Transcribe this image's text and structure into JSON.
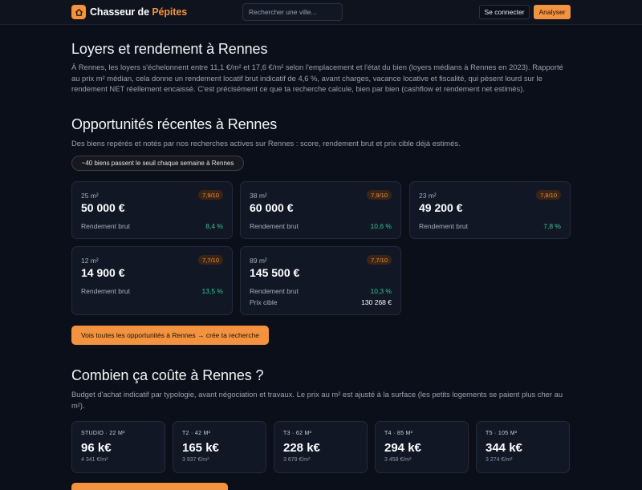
{
  "header": {
    "logo_part1": "Chasseur de ",
    "logo_part2": "Pépites",
    "logo_icon": "house-icon",
    "search_placeholder": "Rechercher une ville...",
    "login_label": "Se connecter",
    "analyse_label": "Analyser"
  },
  "rent": {
    "title": "Loyers et rendement à Rennes",
    "text": "À Rennes, les loyers s'échelonnent entre 11,1 €/m² et 17,6 €/m² selon l'emplacement et l'état du bien (loyers médians à Rennes en 2023). Rapporté au prix m² médian, cela donne un rendement locatif brut indicatif de 4,6 %, avant charges, vacance locative et fiscalité, qui pèsent lourd sur le rendement NET réellement encaissé. C'est précisément ce que ta recherche calcule, bien par bien (cashflow et rendement net estimés)."
  },
  "opportunities": {
    "title": "Opportunités récentes à Rennes",
    "subtitle": "Des biens repérés et notés par nos recherches actives sur Rennes : score, rendement brut et prix cible déjà estimés.",
    "pill": "~40 biens passent le seuil chaque semaine à Rennes",
    "yield_label": "Rendement brut",
    "target_label": "Prix cible",
    "cards": [
      {
        "surface": "25 m²",
        "score": "7,9/10",
        "price": "50 000 €",
        "yield": "8,4 %"
      },
      {
        "surface": "38 m²",
        "score": "7,9/10",
        "price": "60 000 €",
        "yield": "10,6 %"
      },
      {
        "surface": "23 m²",
        "score": "7,8/10",
        "price": "49 200 €",
        "yield": "7,8 %"
      },
      {
        "surface": "12 m²",
        "score": "7,7/10",
        "price": "14 900 €",
        "yield": "13,5 %"
      },
      {
        "surface": "89 m²",
        "score": "7,7/10",
        "price": "145 500 €",
        "yield": "10,3 %",
        "target": "130 268 €"
      }
    ],
    "cta": "Vois toutes les opportunités à Rennes → crée ta recherche"
  },
  "budget": {
    "title": "Combien ça coûte à Rennes ?",
    "text": "Budget d'achat indicatif par typologie, avant négociation et travaux. Le prix au m² est ajusté à la surface (les petits logements se paient plus cher au m²).",
    "cards": [
      {
        "type": "STUDIO · 22 M²",
        "price": "96 k€",
        "per_m2": "4 341 €/m²"
      },
      {
        "type": "T2 · 42 M²",
        "price": "165 k€",
        "per_m2": "3 937 €/m²"
      },
      {
        "type": "T3 · 62 M²",
        "price": "228 k€",
        "per_m2": "3 679 €/m²"
      },
      {
        "type": "T4 · 85 M²",
        "price": "294 k€",
        "per_m2": "3 458 €/m²"
      },
      {
        "type": "T5 · 105 M²",
        "price": "344 k€",
        "per_m2": "3 274 €/m²"
      }
    ]
  },
  "colors": {
    "accent": "#f3923f",
    "positive": "#34c38f",
    "background": "#0b0f19",
    "card": "#121726"
  }
}
